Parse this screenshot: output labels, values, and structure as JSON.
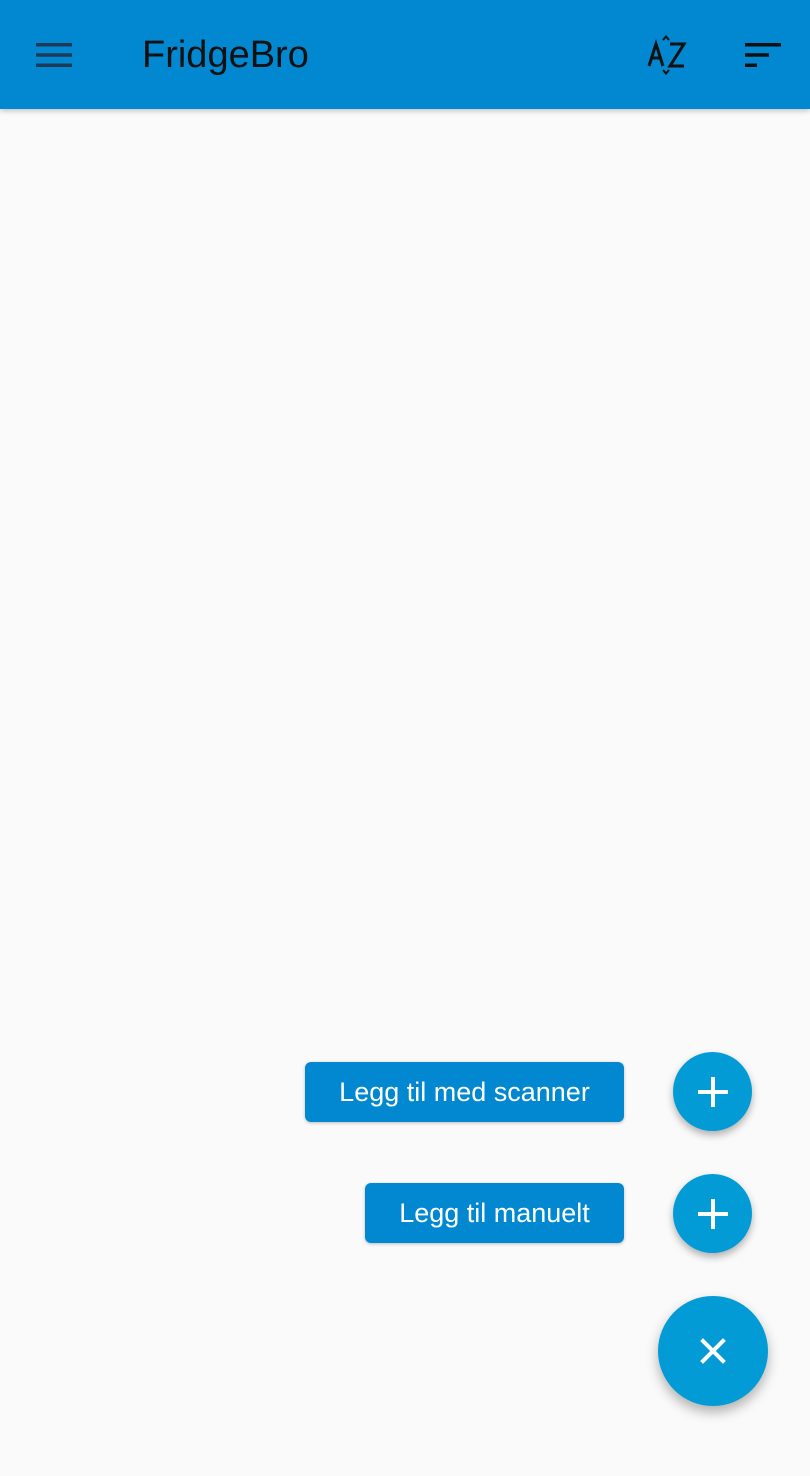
{
  "app_bar": {
    "title": "FridgeBro",
    "menu_icon": "hamburger-menu-icon",
    "az_sort_icon": "sort-alphabetical-icon",
    "sort_icon": "sort-icon",
    "color": "#0288d1"
  },
  "fab_menu": {
    "items": [
      {
        "label": "Legg til med scanner",
        "icon": "plus-icon"
      },
      {
        "label": "Legg til manuelt",
        "icon": "plus-icon"
      }
    ],
    "main_fab_icon": "close-icon",
    "fab_color": "#039bd5"
  }
}
